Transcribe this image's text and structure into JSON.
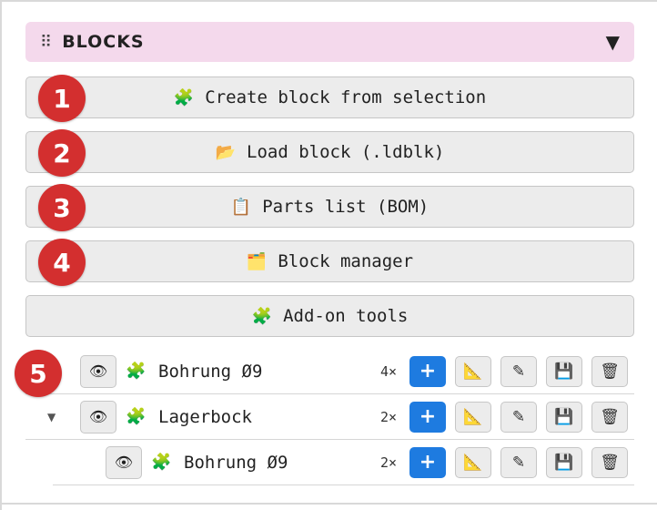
{
  "panel": {
    "title": "BLOCKS",
    "grip_glyph": "⠿",
    "collapse_glyph": "▼"
  },
  "actions": [
    {
      "label": "Create block from selection",
      "icon": "puzzle-icon",
      "glyph": "🧩",
      "badge": "1"
    },
    {
      "label": "Load block (.ldblk)",
      "icon": "folder-open-icon",
      "glyph": "📂",
      "badge": "2"
    },
    {
      "label": "Parts list (BOM)",
      "icon": "clipboard-icon",
      "glyph": "📋",
      "badge": "3"
    },
    {
      "label": "Block manager",
      "icon": "card-index-icon",
      "glyph": "🗂️",
      "badge": "4"
    },
    {
      "label": "Add-on tools",
      "icon": "puzzle-icon",
      "glyph": "🧩",
      "badge": ""
    }
  ],
  "list_badge": "5",
  "blocks": [
    {
      "name": "Bohrung Ø9",
      "count": "4×",
      "level": 0,
      "expandable": false
    },
    {
      "name": "Lagerbock",
      "count": "2×",
      "level": 0,
      "expandable": true,
      "caret": "▼"
    },
    {
      "name": "Bohrung Ø9",
      "count": "2×",
      "level": 1,
      "expandable": false
    }
  ],
  "row_tools": {
    "eye": "👁",
    "plus": "+",
    "measure": "📐",
    "edit": "✎",
    "save": "💾",
    "delete": "🗑"
  },
  "colors": {
    "header_bg": "#f4d9ec",
    "badge_red": "#d32f2f",
    "plus_blue": "#1e7be0",
    "button_bg": "#ececec"
  }
}
